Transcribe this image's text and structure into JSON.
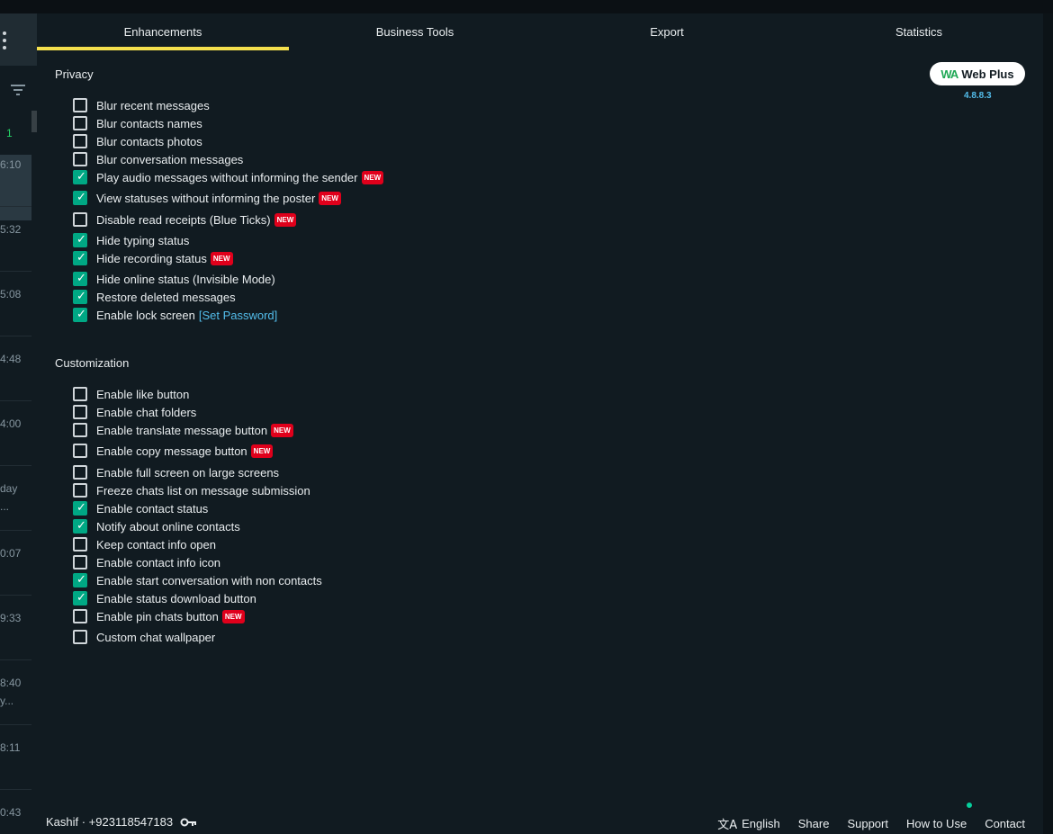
{
  "tabs": [
    {
      "label": "Enhancements",
      "active": true
    },
    {
      "label": "Business Tools",
      "active": false
    },
    {
      "label": "Export",
      "active": false
    },
    {
      "label": "Statistics",
      "active": false
    }
  ],
  "chat_list": {
    "unread": "1",
    "times": [
      "6:10",
      "5:32",
      "5:08",
      "4:48",
      "4:00",
      "day",
      "...",
      "0:07",
      "9:33",
      "8:40",
      "y...",
      "8:11",
      "0:43"
    ]
  },
  "brand": {
    "logo": "WA",
    "name": "Web Plus",
    "version": "4.8.8.3"
  },
  "new_badge": "NEW",
  "privacy": {
    "title": "Privacy",
    "options": [
      {
        "label": "Blur recent messages",
        "checked": false,
        "new": false
      },
      {
        "label": "Blur contacts names",
        "checked": false,
        "new": false
      },
      {
        "label": "Blur contacts photos",
        "checked": false,
        "new": false
      },
      {
        "label": "Blur conversation messages",
        "checked": false,
        "new": false
      },
      {
        "label": "Play audio messages without informing the sender",
        "checked": true,
        "new": true
      },
      {
        "label": "View statuses without informing the poster",
        "checked": true,
        "new": true
      },
      {
        "label": "Disable read receipts (Blue Ticks)",
        "checked": false,
        "new": true
      },
      {
        "label": "Hide typing status",
        "checked": true,
        "new": false
      },
      {
        "label": "Hide recording status",
        "checked": true,
        "new": true
      },
      {
        "label": "Hide online status (Invisible Mode)",
        "checked": true,
        "new": false
      },
      {
        "label": "Restore deleted messages",
        "checked": true,
        "new": false
      },
      {
        "label": "Enable lock screen",
        "checked": true,
        "new": false,
        "link": "[Set Password]"
      }
    ]
  },
  "customization": {
    "title": "Customization",
    "options": [
      {
        "label": "Enable like button",
        "checked": false,
        "new": false
      },
      {
        "label": "Enable chat folders",
        "checked": false,
        "new": false
      },
      {
        "label": "Enable translate message button",
        "checked": false,
        "new": true
      },
      {
        "label": "Enable copy message button",
        "checked": false,
        "new": true
      },
      {
        "label": "Enable full screen on large screens",
        "checked": false,
        "new": false
      },
      {
        "label": "Freeze chats list on message submission",
        "checked": false,
        "new": false
      },
      {
        "label": "Enable contact status",
        "checked": true,
        "new": false
      },
      {
        "label": "Notify about online contacts",
        "checked": true,
        "new": false
      },
      {
        "label": "Keep contact info open",
        "checked": false,
        "new": false
      },
      {
        "label": "Enable contact info icon",
        "checked": false,
        "new": false
      },
      {
        "label": "Enable start conversation with non contacts",
        "checked": true,
        "new": false
      },
      {
        "label": "Enable status download button",
        "checked": true,
        "new": false
      },
      {
        "label": "Enable pin chats button",
        "checked": false,
        "new": true
      },
      {
        "label": "Custom chat wallpaper",
        "checked": false,
        "new": false
      }
    ]
  },
  "footer": {
    "user": "Kashif · +923118547183",
    "key_icon": "key-icon",
    "language_icon": "translate-icon",
    "language": "English",
    "links": [
      "Share",
      "Support",
      "How to Use",
      "Contact"
    ]
  },
  "colors": {
    "accent": "#00a884",
    "tab_indicator": "#f4e04d",
    "new_badge": "#e0001b",
    "link": "#53bdeb",
    "background": "#111b21"
  }
}
